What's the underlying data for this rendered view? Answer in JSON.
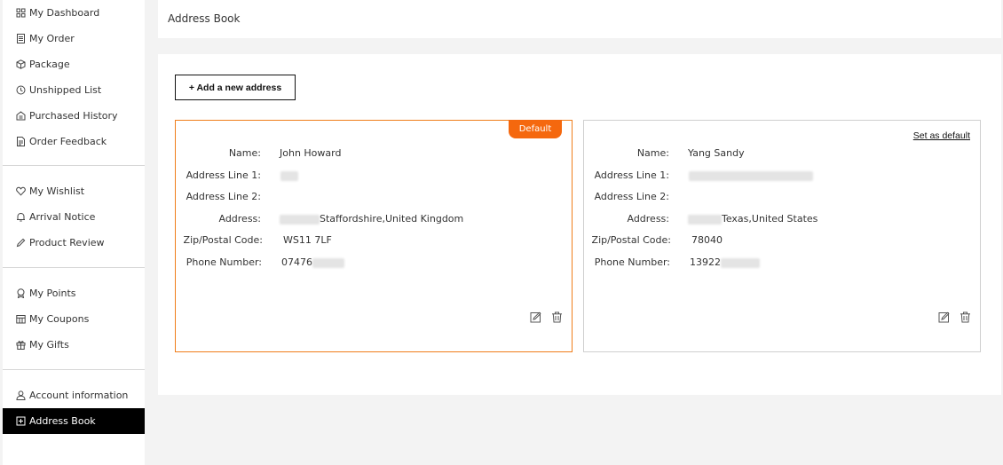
{
  "sidebar": {
    "groups": [
      [
        {
          "label": "My Dashboard",
          "icon": "dashboard-icon"
        },
        {
          "label": "My Order",
          "icon": "order-icon"
        },
        {
          "label": "Package",
          "icon": "package-icon"
        },
        {
          "label": "Unshipped List",
          "icon": "clock-icon"
        },
        {
          "label": "Purchased History",
          "icon": "history-icon"
        },
        {
          "label": "Order Feedback",
          "icon": "feedback-icon"
        }
      ],
      [
        {
          "label": "My Wishlist",
          "icon": "heart-icon"
        },
        {
          "label": "Arrival Notice",
          "icon": "bell-icon"
        },
        {
          "label": "Product Review",
          "icon": "pencil-icon"
        }
      ],
      [
        {
          "label": "My Points",
          "icon": "medal-icon"
        },
        {
          "label": "My Coupons",
          "icon": "coupon-icon"
        },
        {
          "label": "My Gifts",
          "icon": "gift-icon"
        }
      ],
      [
        {
          "label": "Account information",
          "icon": "user-icon"
        },
        {
          "label": "Address Book",
          "icon": "address-book-icon",
          "active": true
        }
      ]
    ]
  },
  "header": {
    "title": "Address Book"
  },
  "main": {
    "add_button_label": "+ Add a new address",
    "labels": {
      "name": "Name:",
      "line1": "Address Line 1:",
      "line2": "Address Line 2:",
      "address": "Address:",
      "zip": "Zip/Postal Code:",
      "phone": "Phone Number:"
    },
    "cards": [
      {
        "badge": "Default",
        "name": "John Howard",
        "address": "Staffordshire,United Kingdom",
        "zip": "WS11 7LF",
        "phone": "07476"
      },
      {
        "set_default_label": "Set as default",
        "name": "Yang Sandy",
        "address": "Texas,United States",
        "zip": "78040",
        "phone": "13922"
      }
    ]
  },
  "colors": {
    "accent": "#f5680e",
    "active_bg": "#000000"
  }
}
